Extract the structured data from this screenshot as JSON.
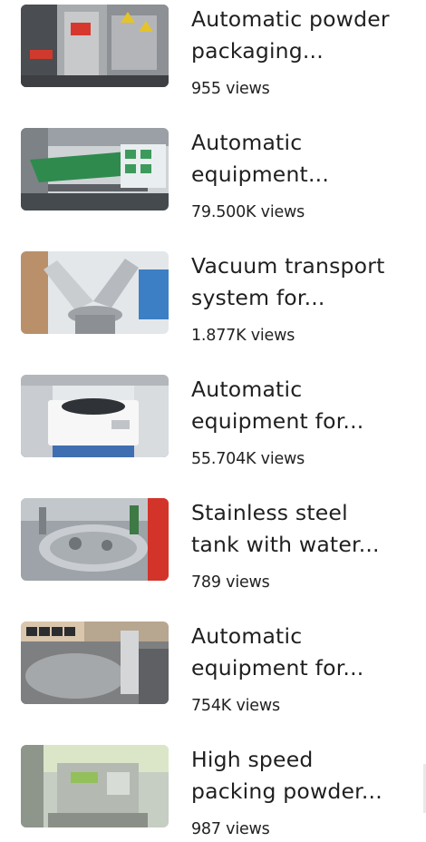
{
  "videos": [
    {
      "title_line1": "Automatic powder",
      "title_line2": "packaging...",
      "views": "955 views",
      "thumb_icon": "powder-packaging-machine-thumbnail"
    },
    {
      "title_line1": "Automatic",
      "title_line2": "equipment...",
      "views": "79.500K views",
      "thumb_icon": "conveyor-equipment-thumbnail"
    },
    {
      "title_line1": "Vacuum transport",
      "title_line2": "system for...",
      "views": "1.877K views",
      "thumb_icon": "vacuum-mixer-thumbnail"
    },
    {
      "title_line1": "Automatic",
      "title_line2": "equipment for...",
      "views": "55.704K views",
      "thumb_icon": "centrifuge-thumbnail"
    },
    {
      "title_line1": "Stainless steel",
      "title_line2": "tank with water...",
      "views": "789 views",
      "thumb_icon": "steel-tank-thumbnail"
    },
    {
      "title_line1": "Automatic",
      "title_line2": "equipment for...",
      "views": "754K views",
      "thumb_icon": "tablet-press-thumbnail"
    },
    {
      "title_line1": "High speed",
      "title_line2": "packing powder...",
      "views": "987 views",
      "thumb_icon": "packing-powder-machine-thumbnail"
    }
  ]
}
